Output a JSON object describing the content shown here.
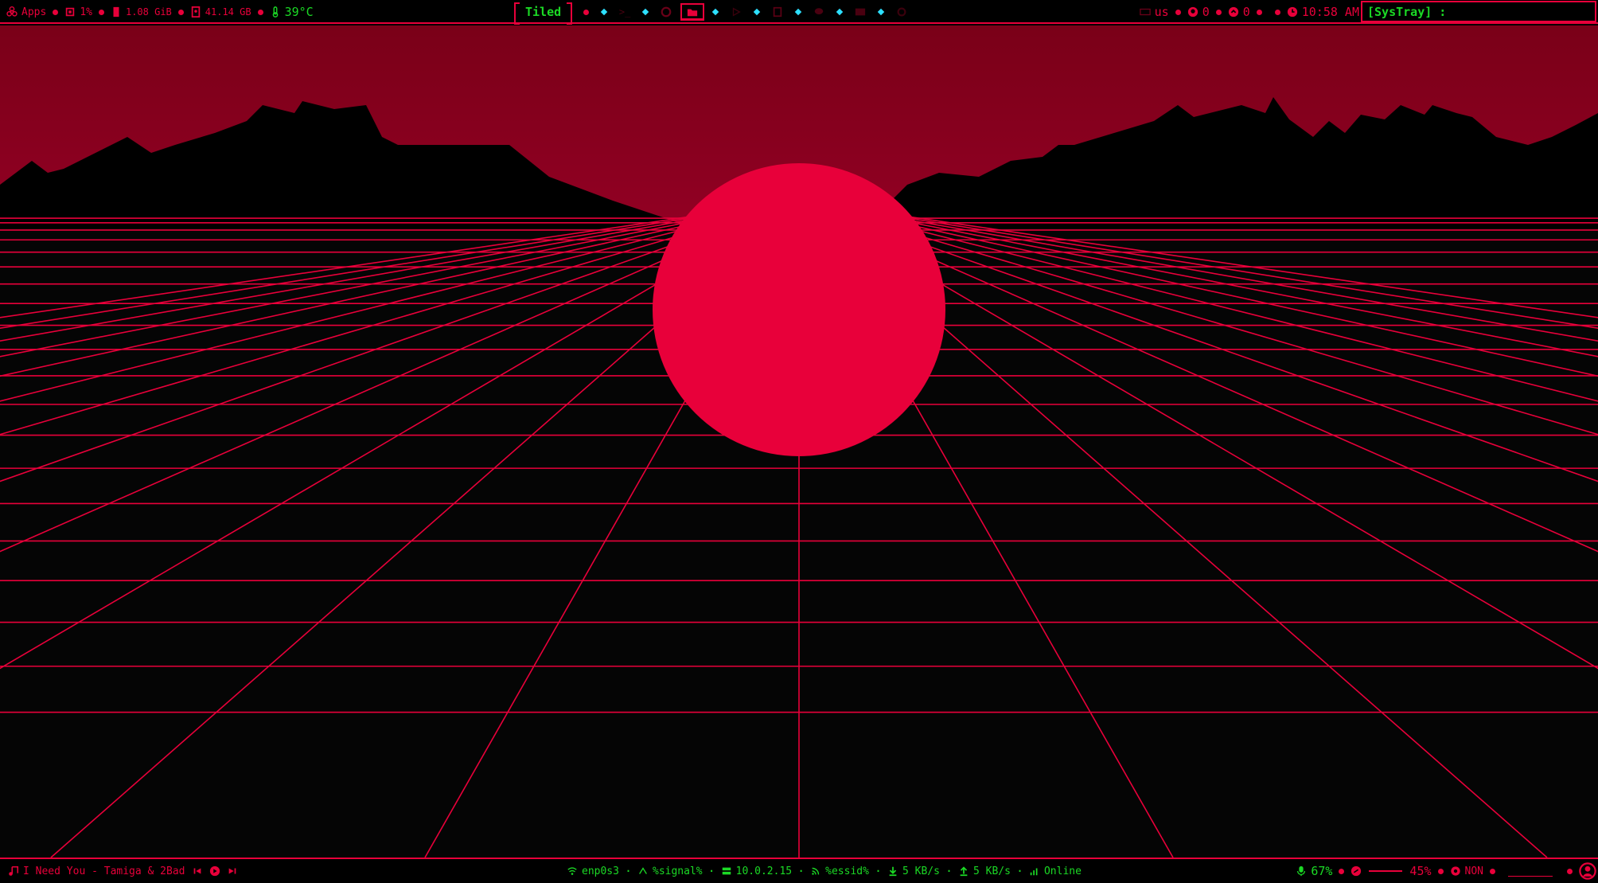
{
  "colors": {
    "accent": "#e8003a",
    "text_ok": "#1bd925",
    "sky_top": "#7a0018",
    "sun": "#e8003a",
    "grid": "#e8003a"
  },
  "top_bar": {
    "apps_label": "Apps",
    "cpu": "1%",
    "memory": "1.08 GiB",
    "disk": "41.14 GB",
    "temperature": "39°C",
    "layout": "Tiled",
    "keyboard_layout": "us",
    "github_count": "0",
    "updates_count": "0",
    "clock": "10:58 AM",
    "systray_label": "[SysTray] :"
  },
  "workspaces": [
    {
      "icon": "terminal-icon",
      "active": false
    },
    {
      "icon": "firefox-icon",
      "active": false
    },
    {
      "icon": "folder-icon",
      "active": true
    },
    {
      "icon": "player-icon",
      "active": false
    },
    {
      "icon": "document-icon",
      "active": false
    },
    {
      "icon": "chat-icon",
      "active": false
    },
    {
      "icon": "mail-icon",
      "active": false
    },
    {
      "icon": "settings-icon",
      "active": false
    }
  ],
  "bottom_bar": {
    "now_playing": "I Need You - Tamiga & 2Bad",
    "interface": "enp0s3",
    "signal": "%signal%",
    "ip": "10.0.2.15",
    "essid": "%essid%",
    "download": "5 KB/s",
    "upload": "5 KB/s",
    "status": "Online",
    "mic": "67%",
    "volume": "45%",
    "brightness_label": "NON"
  }
}
